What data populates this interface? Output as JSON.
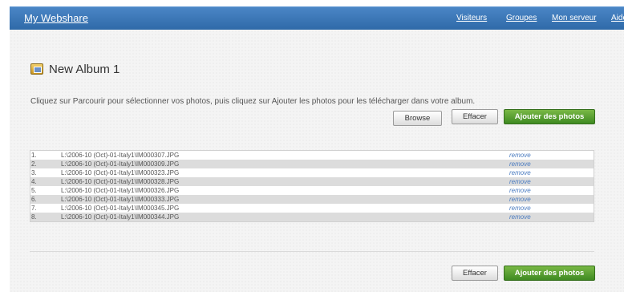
{
  "header": {
    "brand": "My Webshare",
    "nav": [
      "Visiteurs",
      "Groupes",
      "Mon serveur",
      "Aide"
    ]
  },
  "album": {
    "title": "New Album 1",
    "icon": "album-icon"
  },
  "instructions": "Cliquez sur Parcourir pour sélectionner vos photos, puis cliquez sur Ajouter les photos pour les télécharger dans votre album.",
  "buttons": {
    "browse": "Browse",
    "clear": "Effacer",
    "add": "Ajouter des photos"
  },
  "files": [
    {
      "num": "1.",
      "path": "L:\\2006-10 (Oct)-01-Italy1\\IM000307.JPG",
      "action": "remove"
    },
    {
      "num": "2.",
      "path": "L:\\2006-10 (Oct)-01-Italy1\\IM000309.JPG",
      "action": "remove"
    },
    {
      "num": "3.",
      "path": "L:\\2006-10 (Oct)-01-Italy1\\IM000323.JPG",
      "action": "remove"
    },
    {
      "num": "4.",
      "path": "L:\\2006-10 (Oct)-01-Italy1\\IM000328.JPG",
      "action": "remove"
    },
    {
      "num": "5.",
      "path": "L:\\2006-10 (Oct)-01-Italy1\\IM000326.JPG",
      "action": "remove"
    },
    {
      "num": "6.",
      "path": "L:\\2006-10 (Oct)-01-Italy1\\IM000333.JPG",
      "action": "remove"
    },
    {
      "num": "7.",
      "path": "L:\\2006-10 (Oct)-01-Italy1\\IM000345.JPG",
      "action": "remove"
    },
    {
      "num": "8.",
      "path": "L:\\2006-10 (Oct)-01-Italy1\\IM000344.JPG",
      "action": "remove"
    }
  ],
  "colors": {
    "header": "#3a78b8",
    "accent_green": "#4f9a2c",
    "link_blue": "#4a7bc0",
    "row_alt": "#dcdcdc"
  }
}
